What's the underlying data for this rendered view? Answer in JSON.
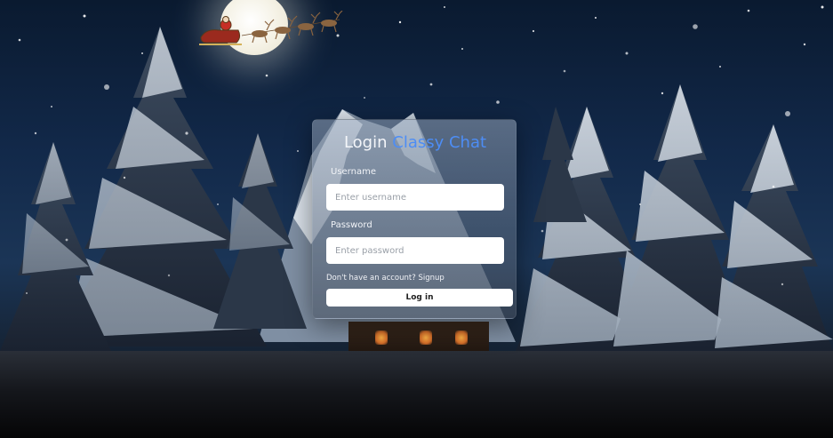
{
  "login": {
    "title_prefix": "Login",
    "title_brand": "Classy Chat",
    "username_label": "Username",
    "username_placeholder": "Enter username",
    "username_value": "",
    "password_label": "Password",
    "password_placeholder": "Enter password",
    "password_value": "",
    "signup_prompt": "Don't have an account?",
    "signup_link": "Signup",
    "login_button": "Log in"
  },
  "colors": {
    "brand_accent": "#4d8df5",
    "card_background": "#8a98ab",
    "input_background": "#ffffff",
    "text_light": "#f1f3f7"
  },
  "background": {
    "scene": "snowy-night-forest",
    "icons": [
      "moon-icon",
      "santa-sleigh-icon"
    ]
  }
}
